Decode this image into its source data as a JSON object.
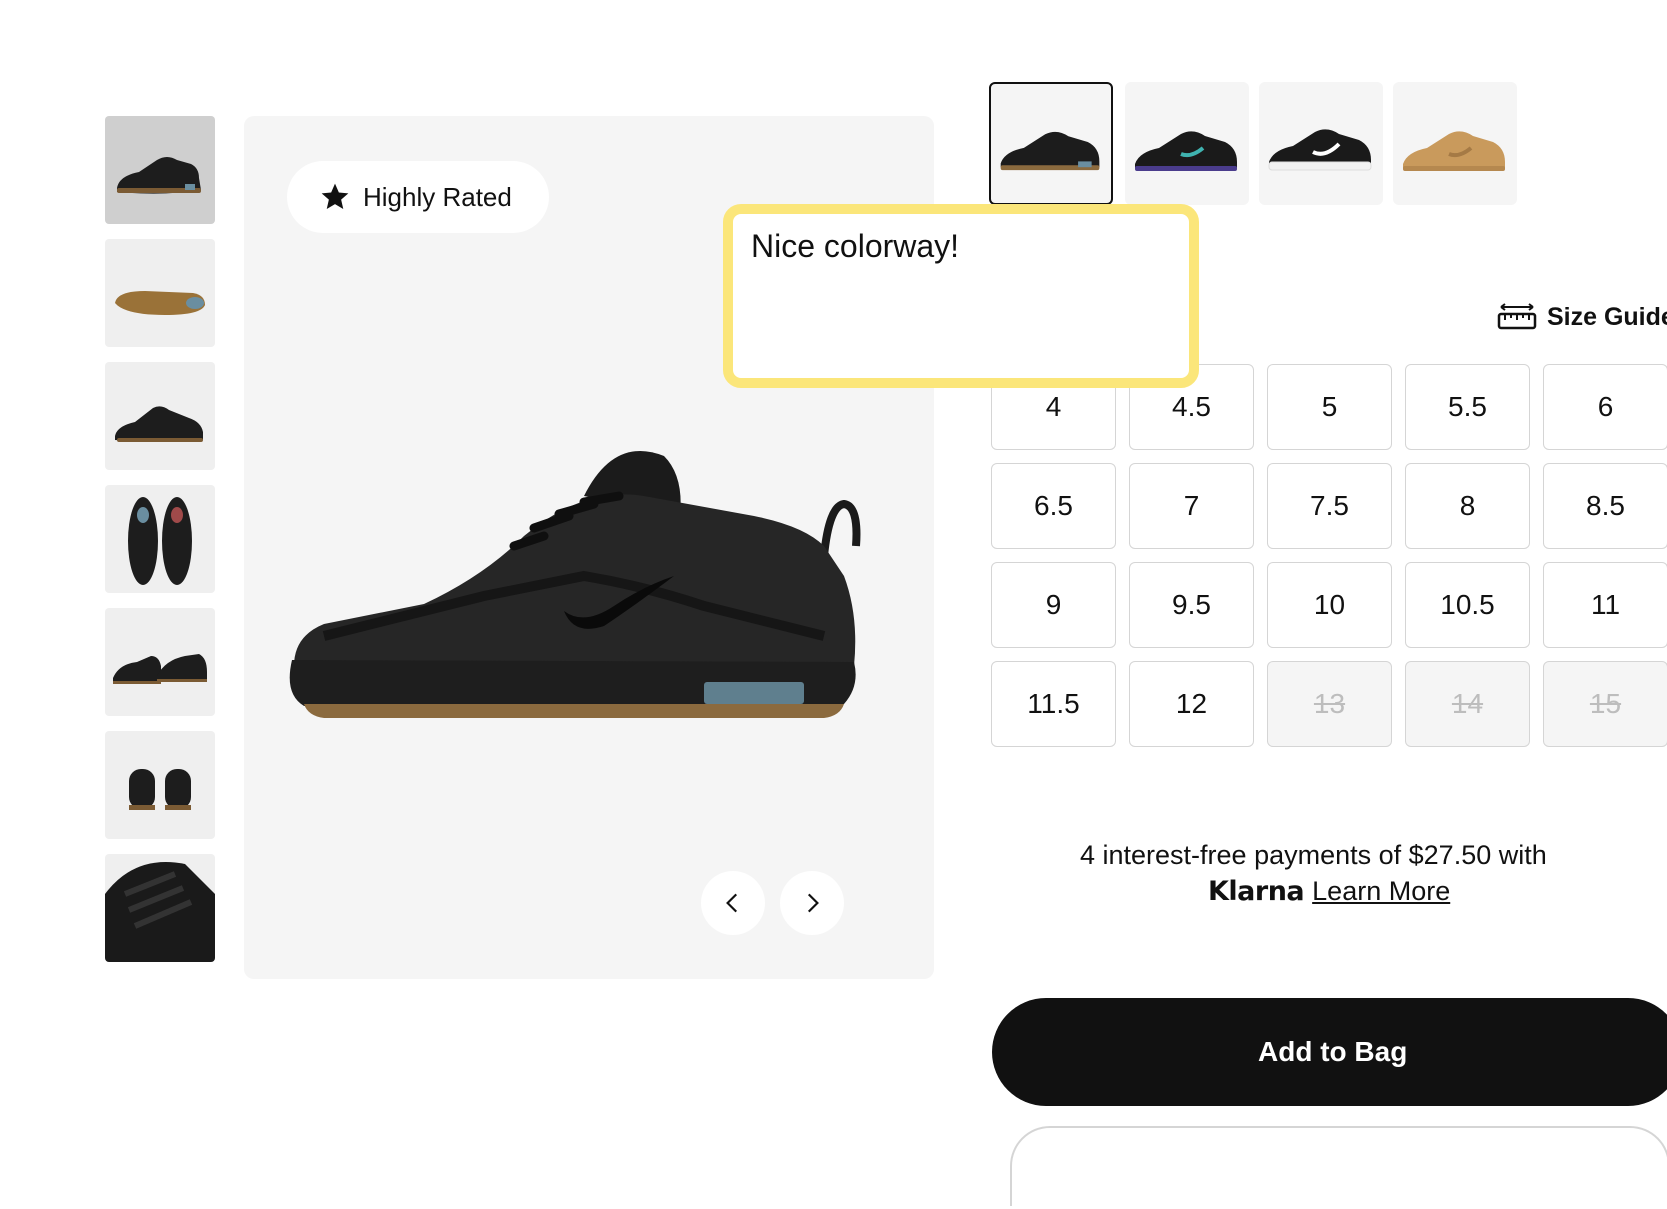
{
  "badge": {
    "label": "Highly Rated",
    "icon": "star-icon"
  },
  "gallery": {
    "thumbnails": [
      {
        "view": "side",
        "active": true
      },
      {
        "view": "sole"
      },
      {
        "view": "side-medial"
      },
      {
        "view": "top-pair"
      },
      {
        "view": "pair-angled"
      },
      {
        "view": "back-pair"
      },
      {
        "view": "detail-closeup"
      }
    ],
    "prev_icon": "chevron-left-icon",
    "next_icon": "chevron-right-icon"
  },
  "colorways": [
    {
      "name": "black-gum",
      "body": "#1c1c1c",
      "sole": "#8b6a3e",
      "accent": "#6a8ea0",
      "selected": true
    },
    {
      "name": "black-purple",
      "body": "#1a1a1a",
      "sole": "#4a3c8c",
      "accent": "#3fb3b0"
    },
    {
      "name": "black-white",
      "body": "#1a1a1a",
      "sole": "#f2f2f2",
      "accent": "#ffffff"
    },
    {
      "name": "wheat",
      "body": "#c99a5c",
      "sole": "#b5884f",
      "accent": "#a57a45"
    }
  ],
  "size_guide": {
    "label": "Size Guide",
    "icon": "ruler-icon"
  },
  "sizes": [
    {
      "label": "4",
      "available": true
    },
    {
      "label": "4.5",
      "available": true
    },
    {
      "label": "5",
      "available": true
    },
    {
      "label": "5.5",
      "available": true
    },
    {
      "label": "6",
      "available": true
    },
    {
      "label": "6.5",
      "available": true
    },
    {
      "label": "7",
      "available": true
    },
    {
      "label": "7.5",
      "available": true
    },
    {
      "label": "8",
      "available": true
    },
    {
      "label": "8.5",
      "available": true
    },
    {
      "label": "9",
      "available": true
    },
    {
      "label": "9.5",
      "available": true
    },
    {
      "label": "10",
      "available": true
    },
    {
      "label": "10.5",
      "available": true
    },
    {
      "label": "11",
      "available": true
    },
    {
      "label": "11.5",
      "available": true
    },
    {
      "label": "12",
      "available": true
    },
    {
      "label": "13",
      "available": false
    },
    {
      "label": "14",
      "available": false
    },
    {
      "label": "15",
      "available": false
    }
  ],
  "klarna": {
    "text": "4 interest-free payments of $27.50 with",
    "logo": "Klarna",
    "link": "Learn More"
  },
  "cta": {
    "add_to_bag": "Add to Bag"
  },
  "note": {
    "text": "Nice colorway!",
    "border_color": "#fbe67a"
  }
}
